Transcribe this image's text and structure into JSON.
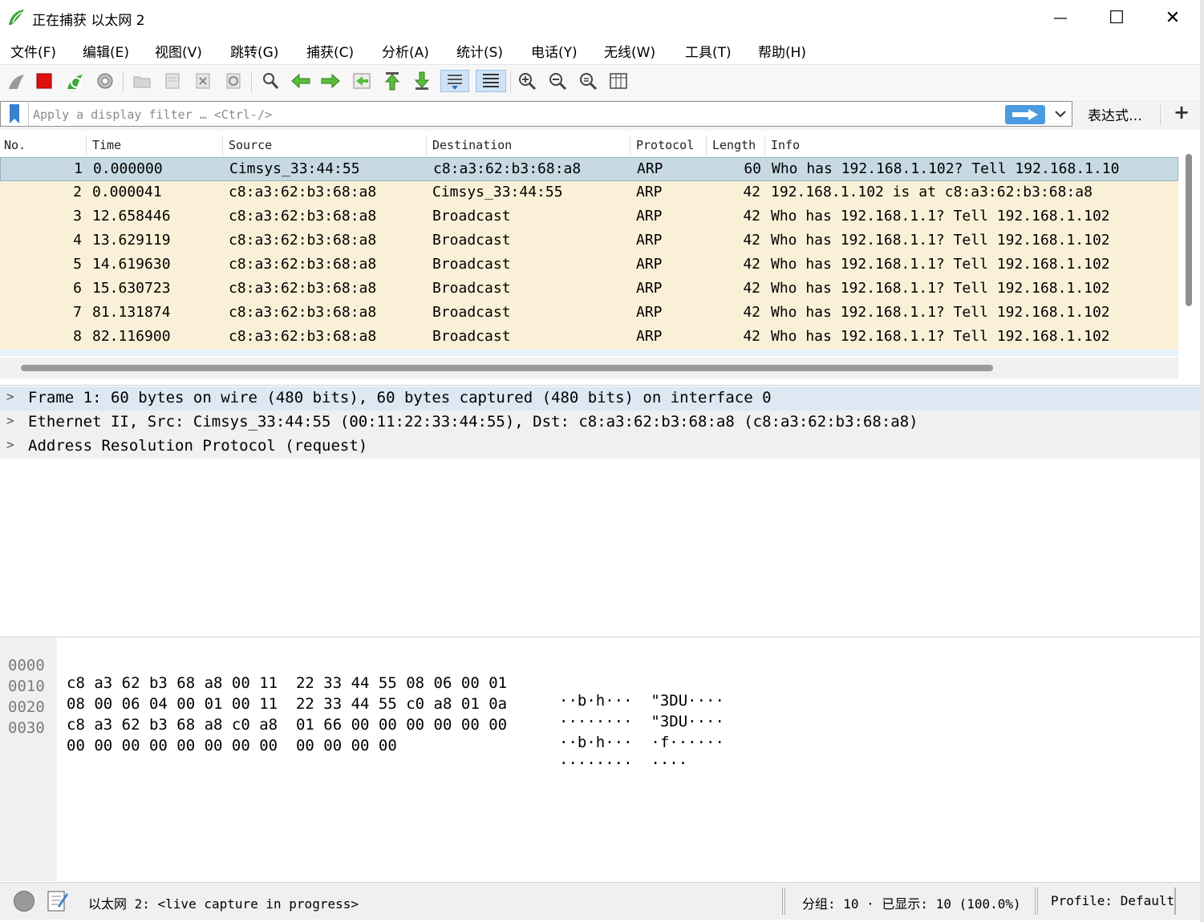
{
  "window": {
    "title": "正在捕获 以太网 2",
    "minimize": "—",
    "maximize": "☐",
    "close": "✕"
  },
  "menu": [
    "文件(F)",
    "编辑(E)",
    "视图(V)",
    "跳转(G)",
    "捕获(C)",
    "分析(A)",
    "统计(S)",
    "电话(Y)",
    "无线(W)",
    "工具(T)",
    "帮助(H)"
  ],
  "toolbar": {
    "icons": [
      "shark-fin-start-icon",
      "stop-capture-icon",
      "restart-capture-icon",
      "capture-options-icon",
      "open-file-icon",
      "save-file-icon",
      "close-file-icon",
      "reload-file-icon",
      "find-packet-icon",
      "go-back-icon",
      "go-forward-icon",
      "go-to-packet-icon",
      "go-first-icon",
      "go-last-icon",
      "autoscroll-icon",
      "colorize-icon",
      "zoom-in-icon",
      "zoom-out-icon",
      "zoom-normal-icon",
      "resize-columns-icon"
    ]
  },
  "filter": {
    "placeholder": "Apply a display filter … <Ctrl-/>",
    "value": "",
    "expression_label": "表达式…",
    "add_label": "+"
  },
  "columns": [
    "No.",
    "Time",
    "Source",
    "Destination",
    "Protocol",
    "Length",
    "Info"
  ],
  "packets": [
    {
      "no": "1",
      "time": "0.000000",
      "src": "Cimsys_33:44:55",
      "dst": "c8:a3:62:b3:68:a8",
      "proto": "ARP",
      "len": "60",
      "info": "Who has 192.168.1.102? Tell 192.168.1.10"
    },
    {
      "no": "2",
      "time": "0.000041",
      "src": "c8:a3:62:b3:68:a8",
      "dst": "Cimsys_33:44:55",
      "proto": "ARP",
      "len": "42",
      "info": "192.168.1.102 is at c8:a3:62:b3:68:a8"
    },
    {
      "no": "3",
      "time": "12.658446",
      "src": "c8:a3:62:b3:68:a8",
      "dst": "Broadcast",
      "proto": "ARP",
      "len": "42",
      "info": "Who has 192.168.1.1? Tell 192.168.1.102"
    },
    {
      "no": "4",
      "time": "13.629119",
      "src": "c8:a3:62:b3:68:a8",
      "dst": "Broadcast",
      "proto": "ARP",
      "len": "42",
      "info": "Who has 192.168.1.1? Tell 192.168.1.102"
    },
    {
      "no": "5",
      "time": "14.619630",
      "src": "c8:a3:62:b3:68:a8",
      "dst": "Broadcast",
      "proto": "ARP",
      "len": "42",
      "info": "Who has 192.168.1.1? Tell 192.168.1.102"
    },
    {
      "no": "6",
      "time": "15.630723",
      "src": "c8:a3:62:b3:68:a8",
      "dst": "Broadcast",
      "proto": "ARP",
      "len": "42",
      "info": "Who has 192.168.1.1? Tell 192.168.1.102"
    },
    {
      "no": "7",
      "time": "81.131874",
      "src": "c8:a3:62:b3:68:a8",
      "dst": "Broadcast",
      "proto": "ARP",
      "len": "42",
      "info": "Who has 192.168.1.1? Tell 192.168.1.102"
    },
    {
      "no": "8",
      "time": "82.116900",
      "src": "c8:a3:62:b3:68:a8",
      "dst": "Broadcast",
      "proto": "ARP",
      "len": "42",
      "info": "Who has 192.168.1.1? Tell 192.168.1.102"
    }
  ],
  "details": [
    "Frame 1: 60 bytes on wire (480 bits), 60 bytes captured (480 bits) on interface 0",
    "Ethernet II, Src: Cimsys_33:44:55 (00:11:22:33:44:55), Dst: c8:a3:62:b3:68:a8 (c8:a3:62:b3:68:a8)",
    "Address Resolution Protocol (request)"
  ],
  "hex": [
    {
      "offset": "0000",
      "bytes": "c8 a3 62 b3 68 a8 00 11  22 33 44 55 08 06 00 01",
      "ascii": "··b·h···  \"3DU····"
    },
    {
      "offset": "0010",
      "bytes": "08 00 06 04 00 01 00 11  22 33 44 55 c0 a8 01 0a",
      "ascii": "········  \"3DU····"
    },
    {
      "offset": "0020",
      "bytes": "c8 a3 62 b3 68 a8 c0 a8  01 66 00 00 00 00 00 00",
      "ascii": "··b·h···  ·f······"
    },
    {
      "offset": "0030",
      "bytes": "00 00 00 00 00 00 00 00  00 00 00 00",
      "ascii": "········  ····"
    }
  ],
  "status": {
    "capture_text": "以太网 2: <live capture in progress>",
    "packets_text": "分组: 10 · 已显示: 10 (100.0%)",
    "profile_text": "Profile: Default"
  },
  "colors": {
    "row_arp": "#faf0d7",
    "row_selected": "#c7dae4",
    "apply_button": "#4b9be1"
  }
}
